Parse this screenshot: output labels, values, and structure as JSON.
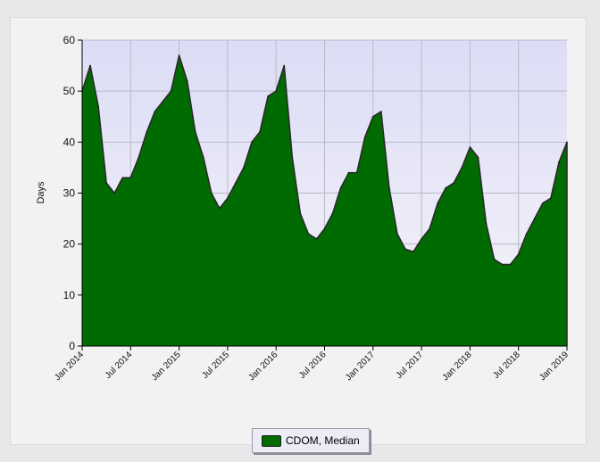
{
  "chart_data": {
    "type": "area",
    "title": "",
    "xlabel": "",
    "ylabel": "Days",
    "ylim": [
      0,
      60
    ],
    "yticks": [
      "0",
      "10",
      "20",
      "30",
      "40",
      "50",
      "60"
    ],
    "xticks": [
      "Jan 2014",
      "Jul 2014",
      "Jan 2015",
      "Jul 2015",
      "Jan 2016",
      "Jul 2016",
      "Jan 2017",
      "Jul 2017",
      "Jan 2018",
      "Jul 2018",
      "Jan 2019"
    ],
    "grid": true,
    "legend_position": "bottom-center",
    "series": [
      {
        "name": "CDOM, Median",
        "color": "#006b00",
        "x": [
          "2014-01",
          "2014-02",
          "2014-03",
          "2014-04",
          "2014-05",
          "2014-06",
          "2014-07",
          "2014-08",
          "2014-09",
          "2014-10",
          "2014-11",
          "2014-12",
          "2015-01",
          "2015-02",
          "2015-03",
          "2015-04",
          "2015-05",
          "2015-06",
          "2015-07",
          "2015-08",
          "2015-09",
          "2015-10",
          "2015-11",
          "2015-12",
          "2016-01",
          "2016-02",
          "2016-03",
          "2016-04",
          "2016-05",
          "2016-06",
          "2016-07",
          "2016-08",
          "2016-09",
          "2016-10",
          "2016-11",
          "2016-12",
          "2017-01",
          "2017-02",
          "2017-03",
          "2017-04",
          "2017-05",
          "2017-06",
          "2017-07",
          "2017-08",
          "2017-09",
          "2017-10",
          "2017-11",
          "2017-12",
          "2018-01",
          "2018-02",
          "2018-03",
          "2018-04",
          "2018-05",
          "2018-06",
          "2018-07",
          "2018-08",
          "2018-09",
          "2018-10",
          "2018-11",
          "2018-12",
          "2019-01"
        ],
        "values": [
          50,
          55,
          47,
          32,
          30,
          33,
          33,
          37,
          42,
          46,
          48,
          50,
          57,
          52,
          42,
          37,
          30,
          27,
          29,
          32,
          35,
          40,
          42,
          49,
          50,
          55,
          37,
          26,
          22,
          21,
          23,
          26,
          31,
          34,
          34,
          41,
          45,
          46,
          31,
          22,
          19,
          18.5,
          21,
          23,
          28,
          31,
          32,
          35,
          39,
          37,
          24,
          17,
          16,
          16,
          18,
          22,
          25,
          28,
          29,
          36,
          40
        ]
      }
    ]
  }
}
